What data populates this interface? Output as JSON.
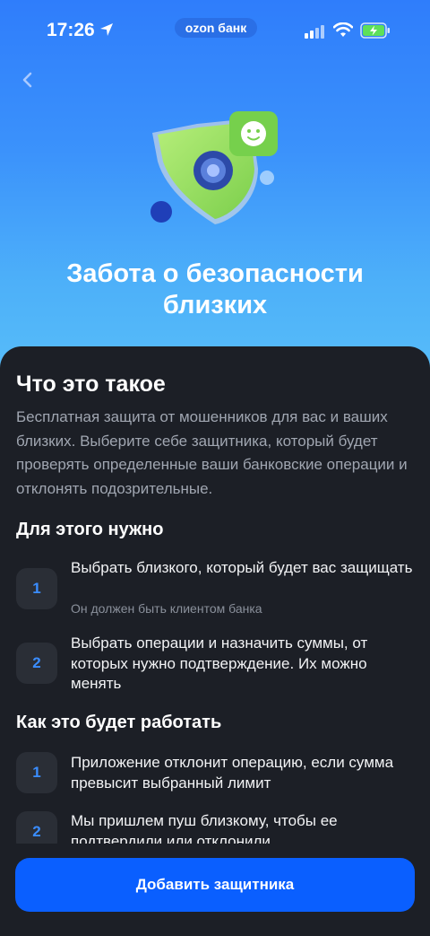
{
  "status_bar": {
    "time": "17:26",
    "carrier": "ozon банк",
    "icons": [
      "location-arrow-icon",
      "signal-icon",
      "wifi-icon",
      "battery-charging-icon"
    ]
  },
  "header": {
    "back_icon": "chevron-left-icon",
    "title_line1": "Забота о безопасности",
    "title_line2": "близких"
  },
  "about": {
    "heading": "Что это такое",
    "description": "Бесплатная защита от мошенников для вас и ваших близких. Выберите себе защитника, который будет проверять определенные ваши банковские операции и отклонять подозрительные."
  },
  "requirements": {
    "heading": "Для этого нужно",
    "steps": [
      {
        "num": "1",
        "text": "Выбрать близкого, который будет вас защищать",
        "sub": "Он должен быть клиентом банка"
      },
      {
        "num": "2",
        "text": "Выбрать операции и назначить суммы, от которых нужно подтверждение. Их можно менять"
      }
    ]
  },
  "how_it_works": {
    "heading": "Как это будет работать",
    "steps": [
      {
        "num": "1",
        "text": "Приложение отклонит операцию, если сумма превысит выбранный лимит"
      },
      {
        "num": "2",
        "text": "Мы пришлем пуш близкому, чтобы ее подтвердили или отклонили"
      }
    ]
  },
  "cta": {
    "label": "Добавить защитника"
  },
  "colors": {
    "accent": "#0a5fff",
    "background": "#1c1f26",
    "step_number": "#3a8dff"
  }
}
